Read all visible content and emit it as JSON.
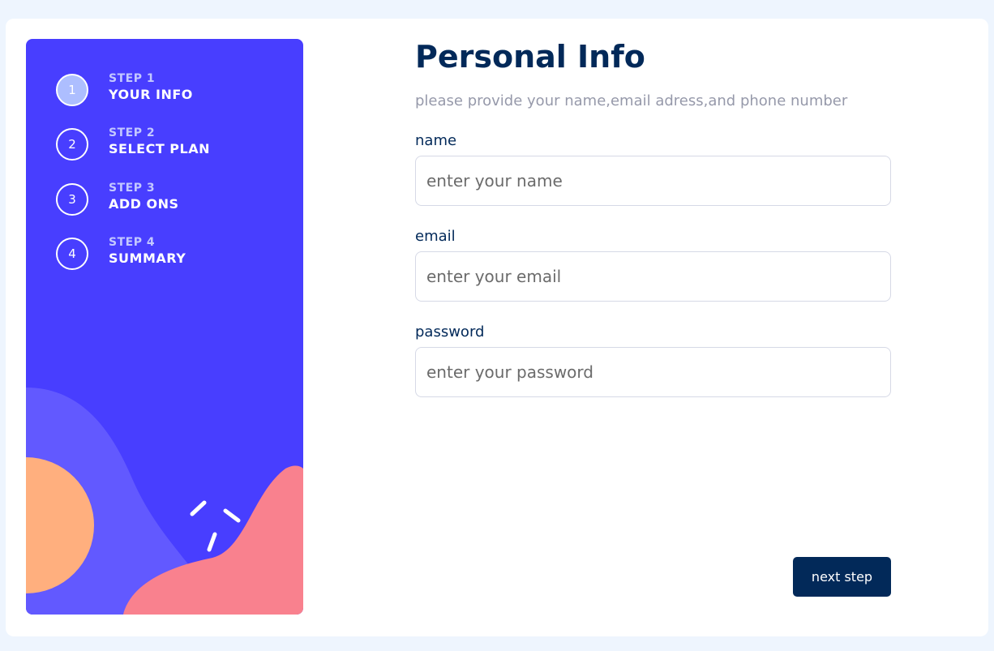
{
  "sidebar": {
    "steps": [
      {
        "number": "1",
        "step_label": "STEP 1",
        "name": "YOUR INFO",
        "active": true
      },
      {
        "number": "2",
        "step_label": "STEP 2",
        "name": "SELECT PLAN",
        "active": false
      },
      {
        "number": "3",
        "step_label": "STEP 3",
        "name": "ADD ONS",
        "active": false
      },
      {
        "number": "4",
        "step_label": "STEP 4",
        "name": "SUMMARY",
        "active": false
      }
    ]
  },
  "main": {
    "title": "Personal Info",
    "subtitle": "please provide your name,email adress,and phone number",
    "fields": {
      "name": {
        "label": "name",
        "placeholder": "enter your name",
        "value": ""
      },
      "email": {
        "label": "email",
        "placeholder": "enter your email",
        "value": ""
      },
      "password": {
        "label": "password",
        "placeholder": "enter your password",
        "value": ""
      }
    },
    "next_button": "next step"
  },
  "colors": {
    "sidebar_bg": "#483eff",
    "primary_dark": "#022959",
    "subtitle_gray": "#9699aa",
    "page_bg": "#eef5fe",
    "blob_light_blue": "#6259ff",
    "blob_orange": "#ffaf7e",
    "blob_pink": "#f9818e"
  }
}
